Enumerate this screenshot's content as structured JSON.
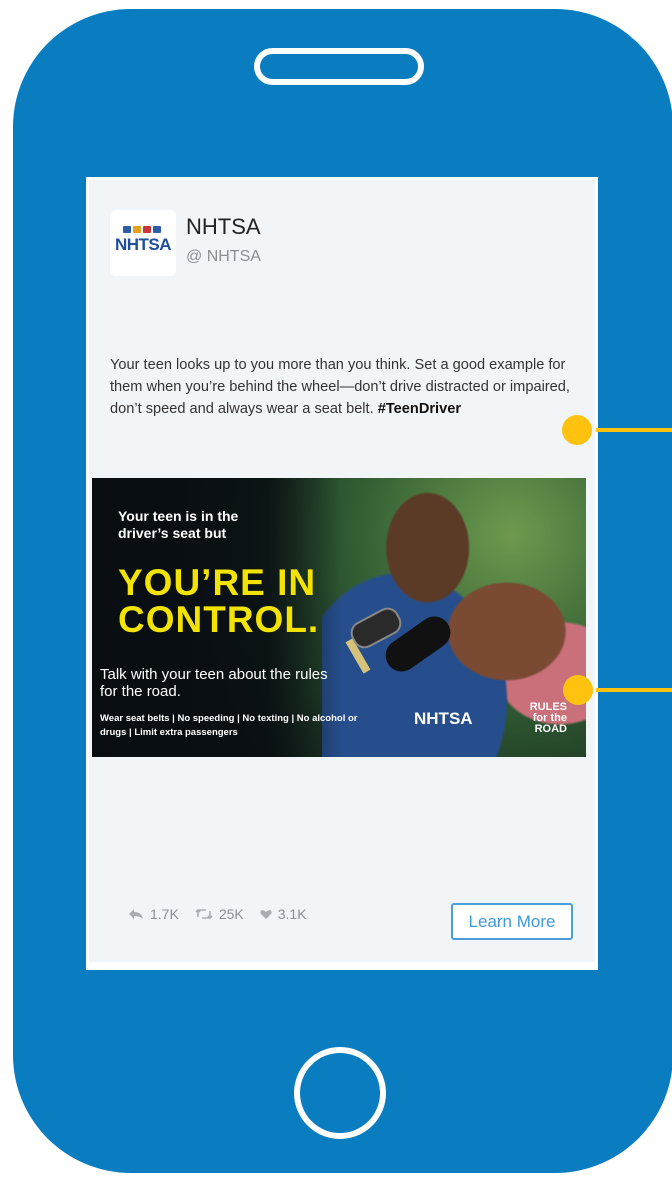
{
  "colors": {
    "phone_body": "#0a7dc0",
    "accent_yellow": "#ffc20e",
    "button_border": "#4a9fd8",
    "headline_yellow": "#f2e300"
  },
  "account": {
    "logo_text": "NHTSA",
    "name": "NHTSA",
    "handle": "@ NHTSA"
  },
  "post": {
    "text": "Your teen looks up to you more than you think. Set a good example for them when you’re behind the wheel—don’t drive distracted or impaired, don’t speed and always wear a seat belt. ",
    "hashtag": "#TeenDriver"
  },
  "ad": {
    "tagline": "Your teen is in the driver’s seat but",
    "headline": "YOU’RE IN CONTROL.",
    "subtext": "Talk with your teen about the rules for the road.",
    "rules": "Wear seat belts | No speeding | No texting | No alcohol or drugs | Limit extra passengers",
    "logo": "NHTSA",
    "road_logo": "RULES for the ROAD"
  },
  "stats": {
    "replies": "1.7K",
    "retweets": "25K",
    "likes": "3.1K",
    "icons": [
      "reply-icon",
      "retweet-icon",
      "heart-icon"
    ]
  },
  "cta": {
    "label": "Learn More"
  }
}
